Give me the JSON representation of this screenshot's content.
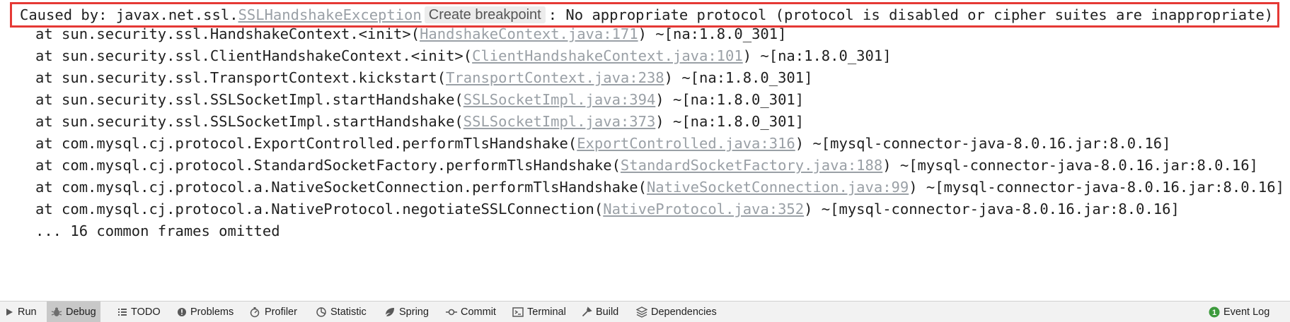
{
  "console": {
    "caused_by": {
      "prefix": "Caused by: javax.net.ssl.",
      "exception_link": "SSLHandshakeException",
      "breakpoint_chip": "Create breakpoint",
      "message": ": No appropriate protocol (protocol is disabled or cipher suites are inappropriate)"
    },
    "frames": [
      {
        "prefix": "at sun.security.ssl.HandshakeContext.<init>(",
        "link": "HandshakeContext.java:171",
        "suffix": ") ~[na:1.8.0_301]"
      },
      {
        "prefix": "at sun.security.ssl.ClientHandshakeContext.<init>(",
        "link": "ClientHandshakeContext.java:101",
        "suffix": ") ~[na:1.8.0_301]"
      },
      {
        "prefix": "at sun.security.ssl.TransportContext.kickstart(",
        "link": "TransportContext.java:238",
        "suffix": ") ~[na:1.8.0_301]"
      },
      {
        "prefix": "at sun.security.ssl.SSLSocketImpl.startHandshake(",
        "link": "SSLSocketImpl.java:394",
        "suffix": ") ~[na:1.8.0_301]"
      },
      {
        "prefix": "at sun.security.ssl.SSLSocketImpl.startHandshake(",
        "link": "SSLSocketImpl.java:373",
        "suffix": ") ~[na:1.8.0_301]"
      },
      {
        "prefix": "at com.mysql.cj.protocol.ExportControlled.performTlsHandshake(",
        "link": "ExportControlled.java:316",
        "suffix": ") ~[mysql-connector-java-8.0.16.jar:8.0.16]"
      },
      {
        "prefix": "at com.mysql.cj.protocol.StandardSocketFactory.performTlsHandshake(",
        "link": "StandardSocketFactory.java:188",
        "suffix": ") ~[mysql-connector-java-8.0.16.jar:8.0.16]"
      },
      {
        "prefix": "at com.mysql.cj.protocol.a.NativeSocketConnection.performTlsHandshake(",
        "link": "NativeSocketConnection.java:99",
        "suffix": ") ~[mysql-connector-java-8.0.16.jar:8.0.16]"
      },
      {
        "prefix": "at com.mysql.cj.protocol.a.NativeProtocol.negotiateSSLConnection(",
        "link": "NativeProtocol.java:352",
        "suffix": ") ~[mysql-connector-java-8.0.16.jar:8.0.16]"
      }
    ],
    "omitted": "... 16 common frames omitted"
  },
  "toolbar": {
    "items": [
      {
        "label": "Run",
        "icon": "run-icon"
      },
      {
        "label": "Debug",
        "icon": "debug-icon",
        "active": true
      },
      {
        "label": "TODO",
        "icon": "todo-icon"
      },
      {
        "label": "Problems",
        "icon": "problems-icon"
      },
      {
        "label": "Profiler",
        "icon": "profiler-icon"
      },
      {
        "label": "Statistic",
        "icon": "statistic-icon"
      },
      {
        "label": "Spring",
        "icon": "spring-icon"
      },
      {
        "label": "Commit",
        "icon": "commit-icon"
      },
      {
        "label": "Terminal",
        "icon": "terminal-icon"
      },
      {
        "label": "Build",
        "icon": "build-icon"
      },
      {
        "label": "Dependencies",
        "icon": "dependencies-icon"
      }
    ],
    "event_log": {
      "label": "Event Log",
      "badge": "1",
      "icon": "event-log-icon"
    }
  },
  "colors": {
    "highlight_border": "#e53935",
    "link": "#9aa0a6",
    "event_log_badge": "#3c9a3c"
  }
}
